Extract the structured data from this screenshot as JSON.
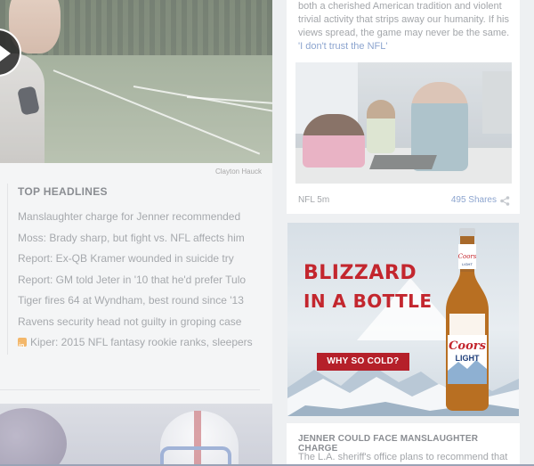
{
  "hero": {
    "credit": "Clayton Hauck",
    "play_icon": "play-icon"
  },
  "headlines": {
    "title": "TOP HEADLINES",
    "items": [
      {
        "text": "Manslaughter charge for Jenner recommended"
      },
      {
        "text": "Moss: Brady sharp, but fight vs. NFL affects him"
      },
      {
        "text": "Report: Ex-QB Kramer wounded in suicide try"
      },
      {
        "text": "Report: GM told Jeter in '10 that he'd prefer Tulo"
      },
      {
        "text": "Tiger fires 64 at Wyndham, best round since '13"
      },
      {
        "text": "Ravens security head not guilty in groping case"
      },
      {
        "text": "Kiper: 2015 NFL fantasy rookie ranks, sleepers",
        "icon": "insider-icon"
      }
    ]
  },
  "story": {
    "text": "both a cherished American tradition and violent trivial activity that strips away our humanity. If his views spread, the game may never be the same.",
    "link": "'I don't trust the NFL'",
    "meta": "NFL 5m",
    "shares": "495 Shares",
    "share_icon": "share-icon"
  },
  "ad": {
    "headline_1": "BLIZZARD",
    "headline_2": "IN A BOTTLE",
    "cta": "WHY SO COLD?",
    "bottle_top_label": "Coors",
    "bottle_top_label_2": "LIGHT",
    "bottle_label_brand": "Coors",
    "bottle_label_sub": "LIGHT",
    "brand_color": "#c3262e"
  },
  "next_story": {
    "title": "JENNER COULD FACE MANSLAUGHTER CHARGE",
    "text": "The L.A. sheriff's office plans to recommend that"
  }
}
